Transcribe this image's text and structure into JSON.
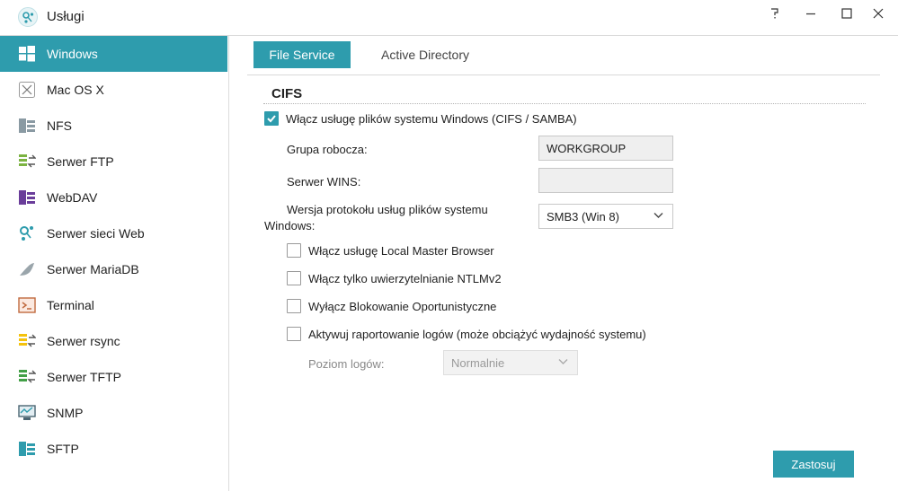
{
  "window": {
    "title": "Usługi"
  },
  "sidebar": {
    "items": [
      {
        "label": "Windows",
        "icon": "windows-logo-icon",
        "active": true
      },
      {
        "label": "Mac OS X",
        "icon": "macos-icon"
      },
      {
        "label": "NFS",
        "icon": "nfs-icon"
      },
      {
        "label": "Serwer FTP",
        "icon": "ftp-server-icon"
      },
      {
        "label": "WebDAV",
        "icon": "webdav-icon"
      },
      {
        "label": "Serwer sieci Web",
        "icon": "web-server-icon"
      },
      {
        "label": "Serwer MariaDB",
        "icon": "mariadb-icon"
      },
      {
        "label": "Terminal",
        "icon": "terminal-icon"
      },
      {
        "label": "Serwer rsync",
        "icon": "rsync-icon"
      },
      {
        "label": "Serwer TFTP",
        "icon": "tftp-icon"
      },
      {
        "label": "SNMP",
        "icon": "snmp-icon"
      },
      {
        "label": "SFTP",
        "icon": "sftp-icon"
      }
    ]
  },
  "tabs": [
    {
      "label": "File Service",
      "active": true
    },
    {
      "label": "Active Directory",
      "active": false
    }
  ],
  "section": {
    "title": "CIFS",
    "enable_label": "Włącz usługę plików systemu Windows (CIFS / SAMBA)",
    "enable_checked": true,
    "workgroup_label": "Grupa robocza:",
    "workgroup_value": "WORKGROUP",
    "wins_label": "Serwer WINS:",
    "wins_value": "",
    "protocol_label_line1": "Wersja protokołu usług plików systemu",
    "protocol_label_line2": "Windows:",
    "protocol_value": "SMB3 (Win 8)",
    "options": [
      {
        "label": "Włącz usługę Local Master Browser",
        "checked": false
      },
      {
        "label": "Włącz tylko uwierzytelnianie NTLMv2",
        "checked": false
      },
      {
        "label": "Wyłącz Blokowanie Oportunistyczne",
        "checked": false
      },
      {
        "label": "Aktywuj raportowanie logów (może obciążyć wydajność systemu)",
        "checked": false
      }
    ],
    "log_level_label": "Poziom logów:",
    "log_level_value": "Normalnie"
  },
  "actions": {
    "apply_label": "Zastosuj"
  },
  "colors": {
    "accent": "#2e9cad"
  }
}
